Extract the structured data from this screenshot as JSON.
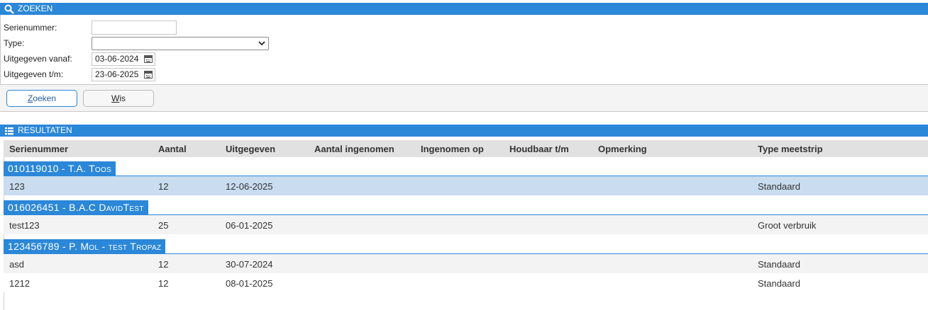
{
  "search_panel": {
    "title": "ZOEKEN",
    "fields": {
      "serienummer_label": "Serienummer:",
      "serienummer_value": "",
      "type_label": "Type:",
      "type_value": "",
      "vanaf_label": "Uitgegeven vanaf:",
      "vanaf_value": "03-06-2024",
      "tm_label": "Uitgegeven t/m:",
      "tm_value": "23-06-2025"
    },
    "buttons": {
      "zoeken_first": "Z",
      "zoeken_rest": "oeken",
      "wis_first": "W",
      "wis_rest": "is"
    }
  },
  "results_panel": {
    "title": "RESULTATEN",
    "columns": [
      "Serienummer",
      "Aantal",
      "Uitgegeven",
      "Aantal ingenomen",
      "Ingenomen op",
      "Houdbaar t/m",
      "Opmerking",
      "Type meetstrip"
    ],
    "groups": [
      {
        "label": "010119010 - T.A. Toos",
        "rows": [
          {
            "serienummer": "123",
            "aantal": "12",
            "uitgegeven": "12-06-2025",
            "type": "Standaard"
          }
        ]
      },
      {
        "label": "016026451 - B.A.C DavidTest",
        "rows": [
          {
            "serienummer": "test123",
            "aantal": "25",
            "uitgegeven": "06-01-2025",
            "type": "Groot verbruik"
          }
        ]
      },
      {
        "label": "123456789 - P. Mol - test Tropaz",
        "rows": [
          {
            "serienummer": "asd",
            "aantal": "12",
            "uitgegeven": "30-07-2024",
            "type": "Standaard"
          },
          {
            "serienummer": "1212",
            "aantal": "12",
            "uitgegeven": "08-01-2025",
            "type": "Standaard"
          }
        ]
      }
    ]
  },
  "colors": {
    "header_blue": "#2b87d8",
    "selected_row": "#c9dcf0"
  }
}
